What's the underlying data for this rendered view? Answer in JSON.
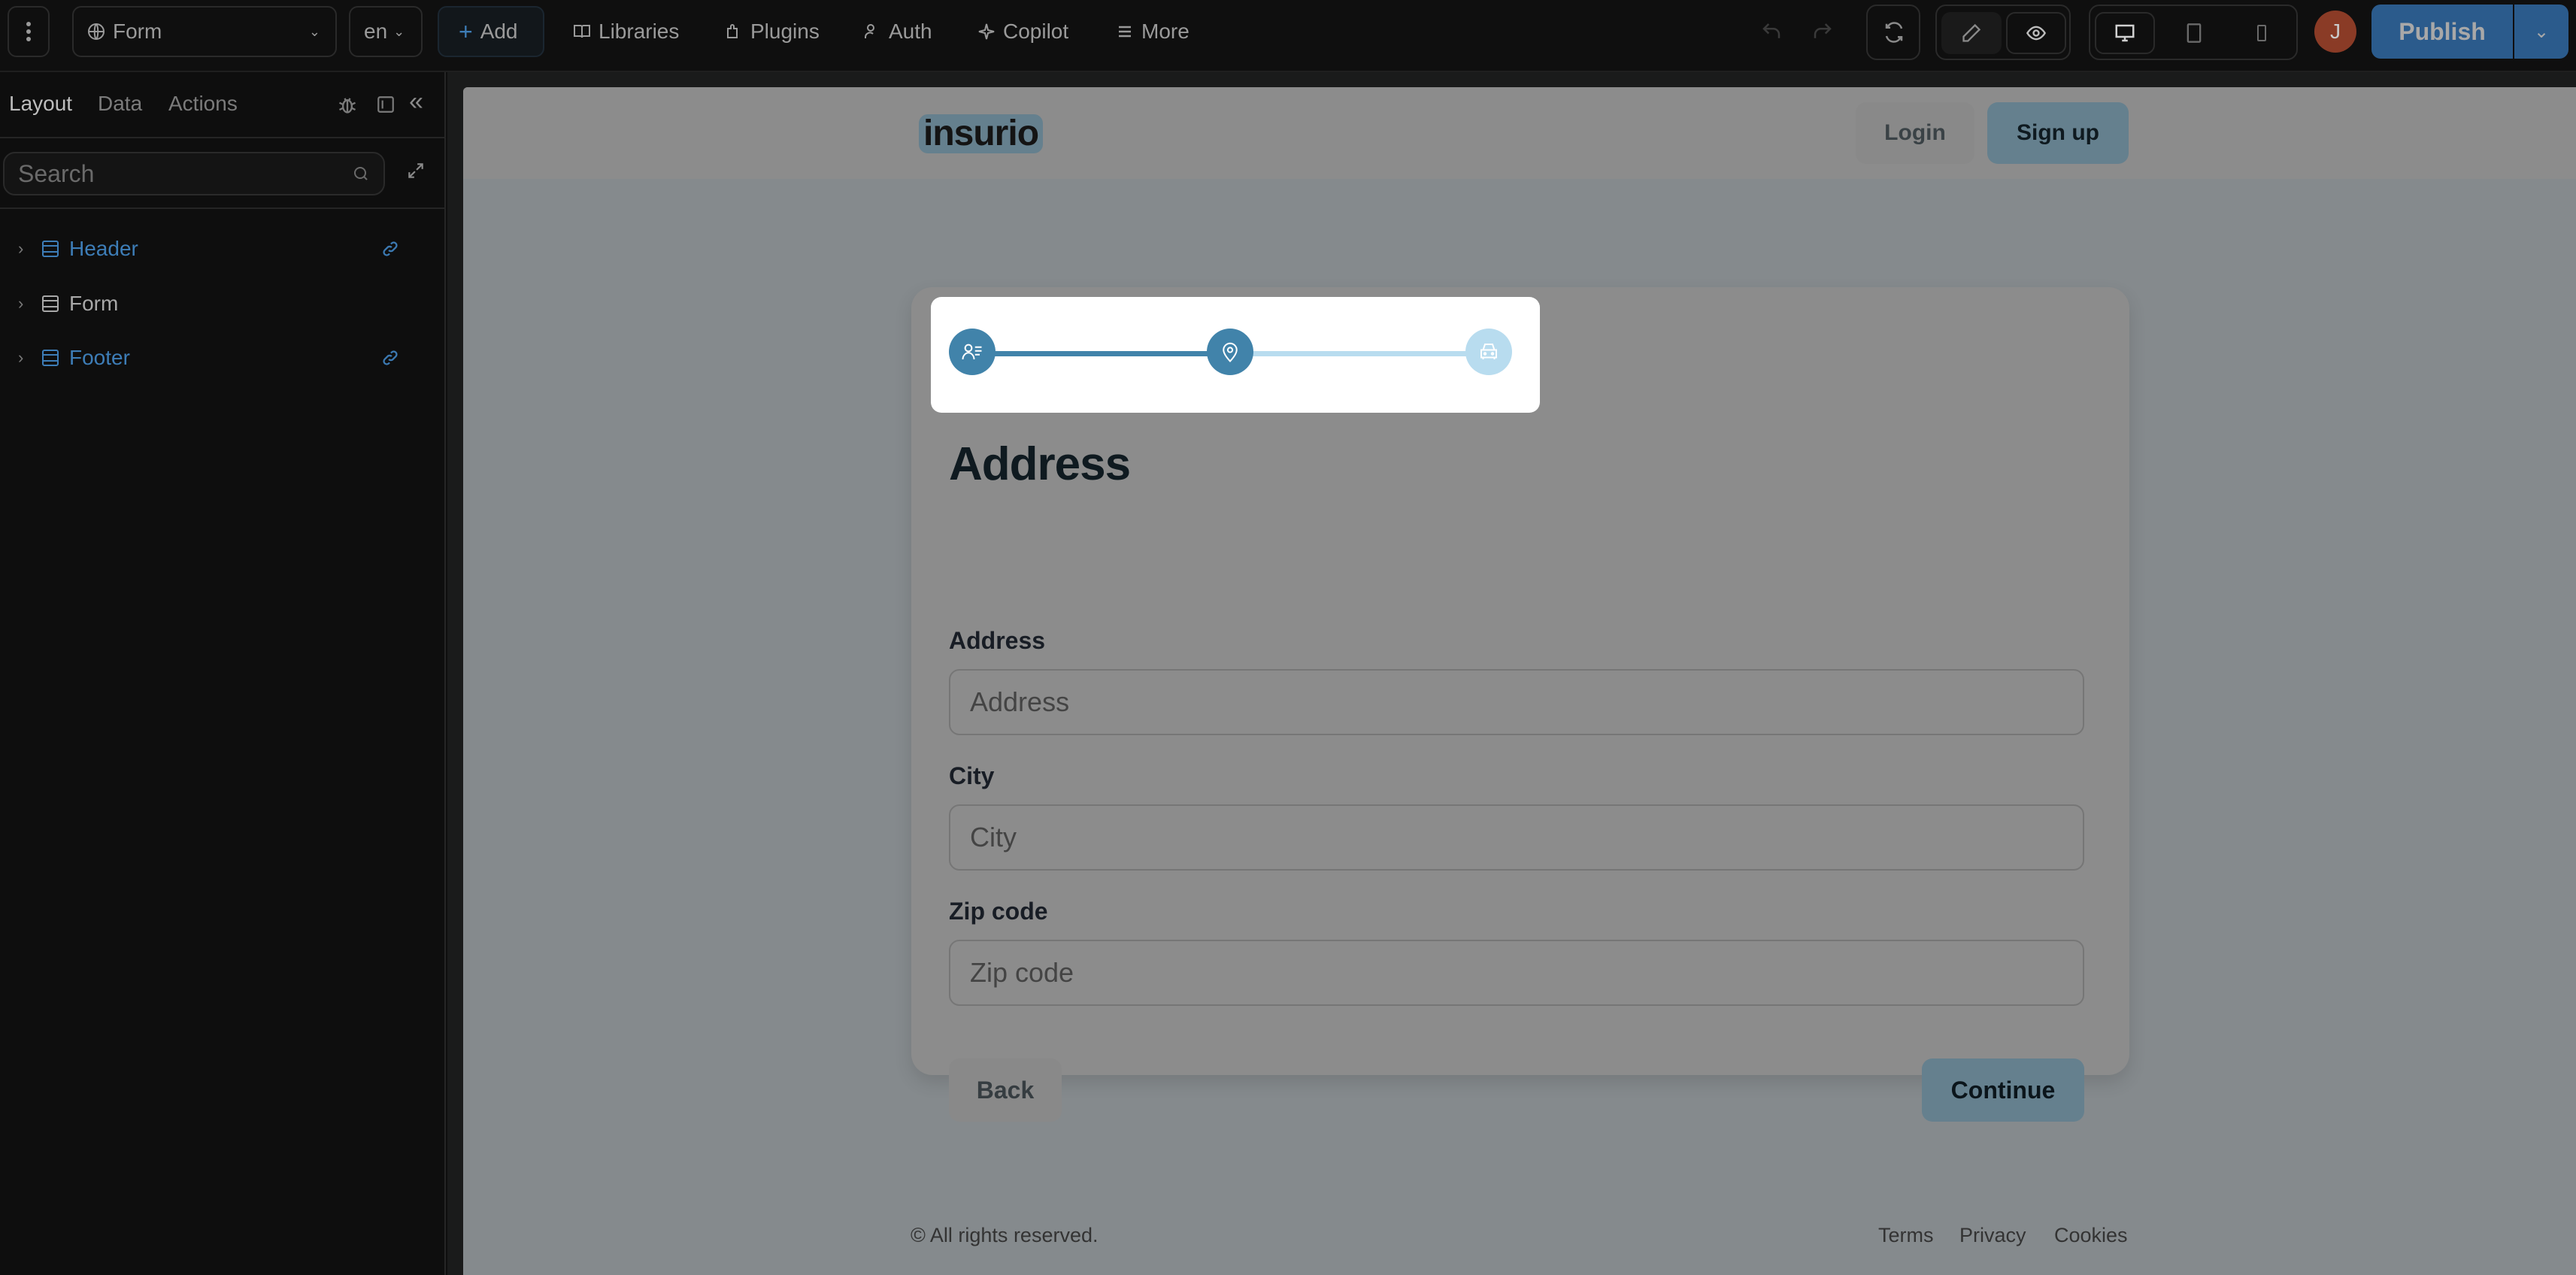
{
  "toolbar": {
    "page_select": "Form",
    "language": "en",
    "add_label": "Add",
    "links": [
      "Libraries",
      "Plugins",
      "Auth",
      "Copilot",
      "More"
    ],
    "avatar_initial": "J",
    "publish_label": "Publish",
    "colors": {
      "publish": "#2b5b8c",
      "avatar": "#8a3b26",
      "accent": "#3d7db7"
    }
  },
  "sidebar": {
    "tabs": [
      "Layout",
      "Data",
      "Actions"
    ],
    "active_tab": "Layout",
    "search_placeholder": "Search",
    "tree": [
      {
        "label": "Header",
        "linked": true
      },
      {
        "label": "Form",
        "linked": false
      },
      {
        "label": "Footer",
        "linked": true
      }
    ]
  },
  "site": {
    "logo": "insurio",
    "header_buttons": {
      "login": "Login",
      "signup": "Sign up"
    },
    "stepper": {
      "steps": [
        {
          "icon": "user-list-icon",
          "state": "complete"
        },
        {
          "icon": "map-pin-icon",
          "state": "current"
        },
        {
          "icon": "car-icon",
          "state": "upcoming"
        }
      ],
      "current_step": 2,
      "total_steps": 3,
      "colors": {
        "active": "#4183aa",
        "inactive": "#b8dcef"
      }
    },
    "form": {
      "title": "Address",
      "fields": [
        {
          "label": "Address",
          "placeholder": "Address",
          "value": ""
        },
        {
          "label": "City",
          "placeholder": "City",
          "value": ""
        },
        {
          "label": "Zip code",
          "placeholder": "Zip code",
          "value": ""
        }
      ],
      "back_label": "Back",
      "continue_label": "Continue"
    },
    "footer": {
      "copyright": "© All rights reserved.",
      "links": [
        "Terms",
        "Privacy",
        "Cookies"
      ]
    }
  }
}
